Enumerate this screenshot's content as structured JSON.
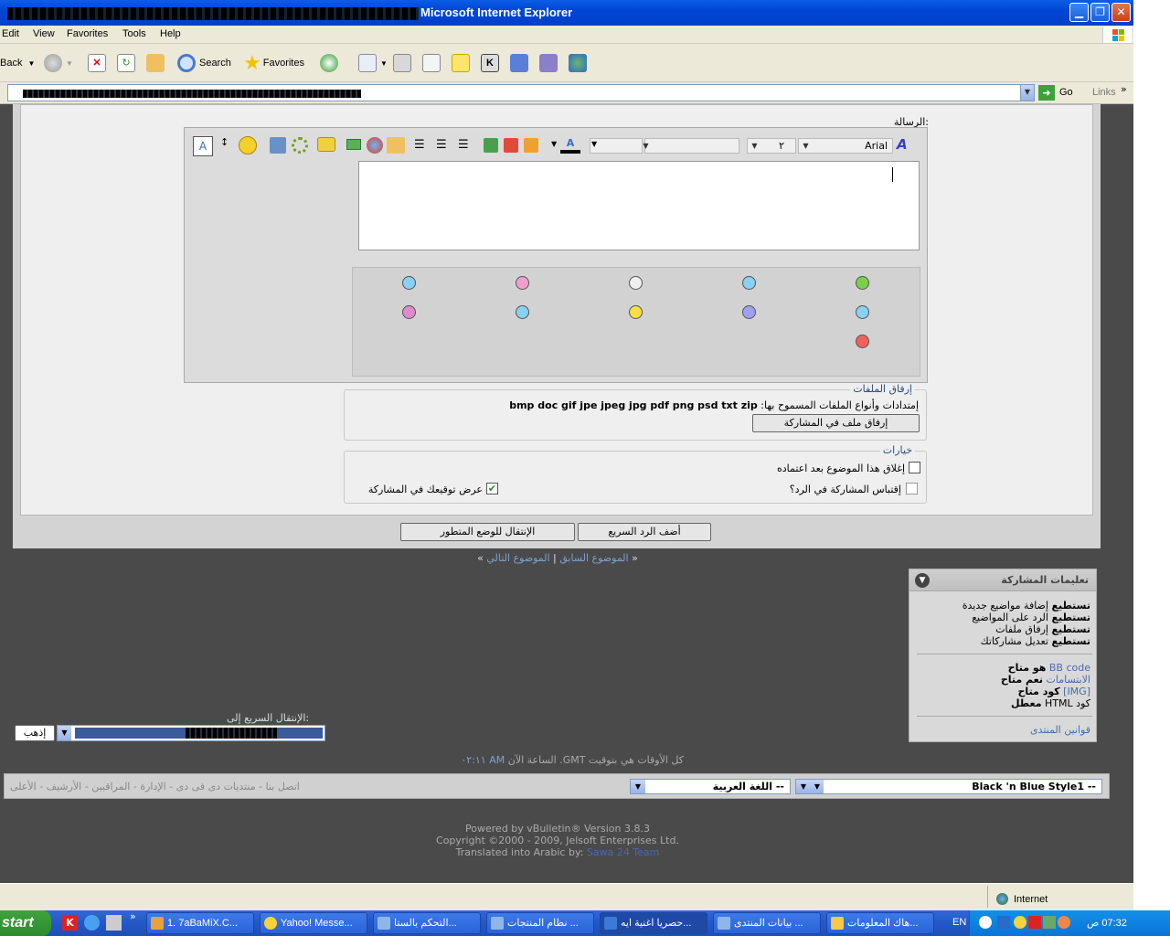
{
  "window": {
    "title_suffix": "Microsoft Internet Explorer"
  },
  "menubar": {
    "items": [
      "Edit",
      "View",
      "Favorites",
      "Tools",
      "Help"
    ]
  },
  "toolbar": {
    "back": "Back",
    "search": "Search",
    "favorites": "Favorites"
  },
  "addressbar": {
    "go": "Go",
    "links": "Links"
  },
  "editor": {
    "message_label": "الرسالة:",
    "font_name": "Arial",
    "font_size": "٢"
  },
  "attachments": {
    "legend": "إرفاق الملفات",
    "allowed_text": "إمتدادات وأنواع الملفات المسموح بها:",
    "extensions": "bmp doc gif jpe jpeg jpg pdf png psd txt zip",
    "attach_button": "إرفاق ملف في المشاركة"
  },
  "options": {
    "legend": "خيارات",
    "close_thread": "إغلاق هذا الموضوع بعد اعتماده",
    "quote_post": "إقتباس المشاركة في الرد؟",
    "show_signature": "عرض توقيعك في المشاركة",
    "show_signature_checked": true
  },
  "buttons": {
    "quick_reply": "أضف الرد السريع",
    "advanced_mode": "الإنتقال للوضع المتطور"
  },
  "thread_nav": {
    "prev": "الموضوع السابق",
    "sep": "|",
    "next": "الموضوع التالي",
    "left_arrow": "»",
    "right_arrow": "«"
  },
  "permissions": {
    "title": "تعليمات المشاركة",
    "lines": [
      {
        "bold": "تستطيع",
        "text": "إضافة مواضيع جديدة"
      },
      {
        "bold": "تستطيع",
        "text": "الرد على المواضيع"
      },
      {
        "bold": "تستطيع",
        "text": "إرفاق ملفات"
      },
      {
        "bold": "تستطيع",
        "text": "تعديل مشاركاتك"
      }
    ],
    "bbcode_link": "BB code",
    "bbcode_status": "هو متاح",
    "smilies_link": "الابتسامات",
    "smilies_status": "نعم متاح",
    "img_link": "[IMG]",
    "img_status": "كود متاح",
    "html_text": "كود HTML",
    "html_status": "معطل",
    "rules_link": "قوانين المنتدى"
  },
  "quick_nav": {
    "label": "الإنتقال السريع إلى:",
    "go_button": "إذهب"
  },
  "times": {
    "text": "كل الأوقات هي بتوقيت GMT. الساعة الآن",
    "time": "AM ٠٢:١١"
  },
  "footer_bar": {
    "style_select": "-- Black 'n Blue Style1",
    "language_select": "-- اللغة العربية",
    "links": "اتصل بنا - منتديات دى فى دى - الإدارة - المراقبين - الأرشيف - الأعلى"
  },
  "credits": {
    "powered": "Powered by vBulletin® Version 3.8.3",
    "copyright": "Copyright ©2000 - 2009, Jelsoft Enterprises Ltd.",
    "translated_prefix": "Translated into Arabic by:",
    "translator": "Sawa 24 Team"
  },
  "statusbar": {
    "zone": "Internet"
  },
  "taskbar": {
    "start": "start",
    "tasks": [
      {
        "label": "1. 7aBaMiX.C...",
        "color": "#e9a23b"
      },
      {
        "label": "Yahoo! Messe...",
        "color": "#f7d23b"
      },
      {
        "label": "التحكم بالستا...",
        "color": "#8fb6e8"
      },
      {
        "label": "نظام المنتجات ...",
        "color": "#8fb6e8"
      },
      {
        "label": "حصريا اغنية ايه...",
        "color": "#3b7ad8"
      },
      {
        "label": "بيانات المنتدى ...",
        "color": "#8fb6e8"
      },
      {
        "label": "هاك المعلومات...",
        "color": "#f7c948"
      }
    ],
    "lang": "EN",
    "clock": "07:32 ص"
  }
}
